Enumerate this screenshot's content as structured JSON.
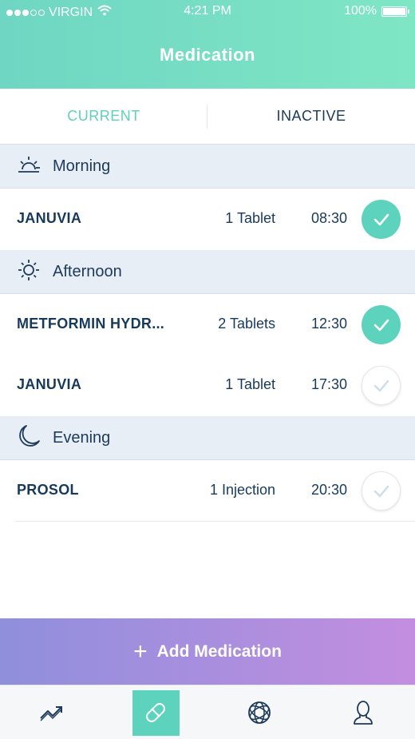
{
  "status_bar": {
    "carrier": "VIRGIN",
    "time": "4:21 PM",
    "battery": "100%",
    "battery_level": 1.0,
    "signal_bars": 3,
    "signal_total": 5
  },
  "header": {
    "title": "Medication"
  },
  "tabs": [
    {
      "label": "CURRENT",
      "active": true
    },
    {
      "label": "INACTIVE",
      "active": false
    }
  ],
  "sections": [
    {
      "label": "Morning",
      "icon": "sunrise-icon",
      "items": [
        {
          "name": "JANUVIA",
          "dose": "1 Tablet",
          "time": "08:30",
          "taken": true
        }
      ]
    },
    {
      "label": "Afternoon",
      "icon": "sun-icon",
      "items": [
        {
          "name": "METFORMIN HYDR...",
          "dose": "2 Tablets",
          "time": "12:30",
          "taken": true
        },
        {
          "name": "JANUVIA",
          "dose": "1 Tablet",
          "time": "17:30",
          "taken": false
        }
      ]
    },
    {
      "label": "Evening",
      "icon": "moon-icon",
      "items": [
        {
          "name": "PROSOL",
          "dose": "1 Injection",
          "time": "20:30",
          "taken": false
        }
      ]
    }
  ],
  "add_button": {
    "label": "Add Medication",
    "icon": "plus-icon"
  },
  "tab_bar": [
    {
      "icon": "trend-icon",
      "active": false
    },
    {
      "icon": "pill-icon",
      "active": true
    },
    {
      "icon": "orbit-icon",
      "active": false
    },
    {
      "icon": "profile-icon",
      "active": false
    }
  ],
  "colors": {
    "accent": "#5dd3be",
    "header_gradient": [
      "#6fd6c3",
      "#7fe6c4"
    ],
    "button_gradient": [
      "#8f8fdc",
      "#c38ee0"
    ],
    "text_dark": "#173a5c",
    "section_bg": "#e7eef5"
  }
}
